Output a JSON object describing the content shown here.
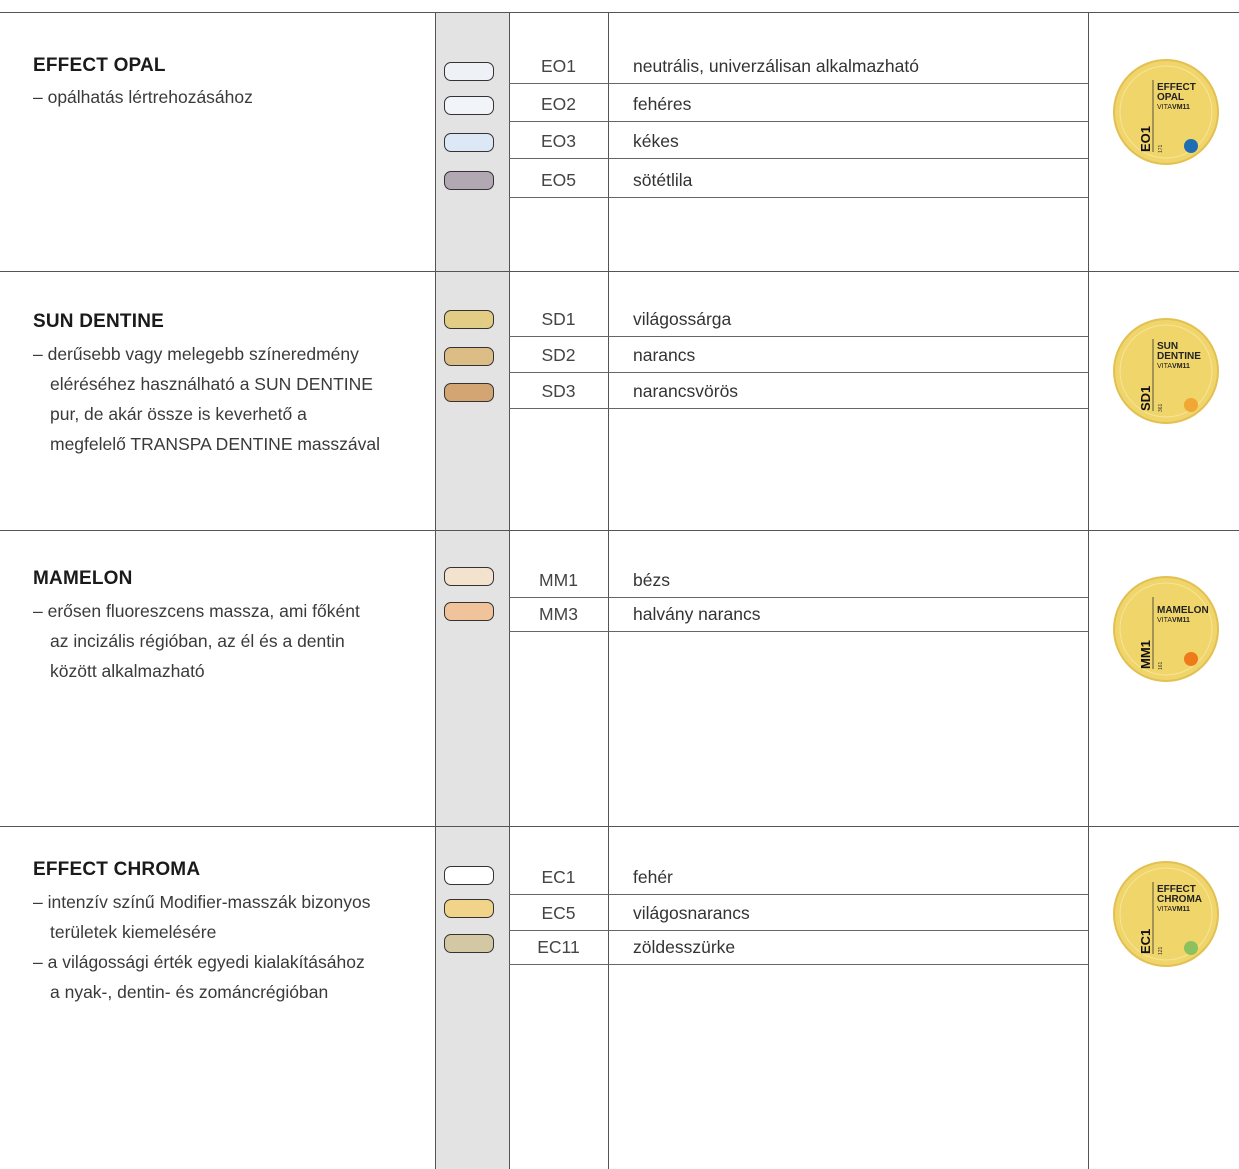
{
  "colors": {
    "line": "#555555",
    "swatch_column": "#e3e3e3",
    "jar_fill": "#f0d56a"
  },
  "sections": [
    {
      "title": "EFFECT OPAL",
      "desc": [
        "– opálhatás lértrehozásához"
      ],
      "items": [
        {
          "code": "EO1",
          "name": "neutrális, univerzálisan alkalmazható",
          "swatch": "#eef1f6"
        },
        {
          "code": "EO2",
          "name": "fehéres",
          "swatch": "#f1f4f8"
        },
        {
          "code": "EO3",
          "name": "kékes",
          "swatch": "#dde8f6"
        },
        {
          "code": "EO5",
          "name": "sötétlila",
          "swatch": "#b1a8b3"
        }
      ],
      "jar": {
        "line1": "EFFECT",
        "line2": "OPAL",
        "brand_pre": "VITA",
        "brand_bold": "VM",
        "brand_post": "11",
        "code": "EO1",
        "number": "171",
        "dot": "#1f6db2"
      }
    },
    {
      "title": "SUN DENTINE",
      "desc": [
        "– derűsebb vagy melegebb színeredmény",
        "elérés­éhez használható a SUN DENTINE",
        "pur, de akár össze is keverhető a",
        "megfelelő TRANSPA DENTINE masszával"
      ],
      "items": [
        {
          "code": "SD1",
          "name": "világossárga",
          "swatch": "#e3cc84"
        },
        {
          "code": "SD2",
          "name": "narancs",
          "swatch": "#dcbd85"
        },
        {
          "code": "SD3",
          "name": "narancsvörös",
          "swatch": "#d2a572"
        }
      ],
      "jar": {
        "line1": "SUN",
        "line2": "DENTINE",
        "brand_pre": "VITA",
        "brand_bold": "VM",
        "brand_post": "11",
        "code": "SD1",
        "number": "361",
        "dot": "#f1a733"
      }
    },
    {
      "title": "MAMELON",
      "desc": [
        "– erősen fluoreszcens massza, ami főként",
        "az incizális régióban, az él és a dentin",
        "között alkalmazható"
      ],
      "items": [
        {
          "code": "MM1",
          "name": "bézs",
          "swatch": "#f3e2cd"
        },
        {
          "code": "MM3",
          "name": "halvány narancs",
          "swatch": "#f0c39a"
        }
      ],
      "jar": {
        "line1": "MAMELON",
        "line2": "",
        "brand_pre": "VITA",
        "brand_bold": "VM",
        "brand_post": "11",
        "code": "MM1",
        "number": "161",
        "dot": "#ee7b1a"
      }
    },
    {
      "title": "EFFECT CHROMA",
      "desc": [
        "– intenzív színű Modifier-masszák bizonyos",
        "területek kiemelésére",
        "– a világossági érték egyedi kialakításához",
        "a nyak-, dentin- és zománcrégióban"
      ],
      "items": [
        {
          "code": "EC1",
          "name": "fehér",
          "swatch": "#ffffff"
        },
        {
          "code": "EC5",
          "name": "világosnarancs",
          "swatch": "#f1d38a"
        },
        {
          "code": "EC11",
          "name": "zöldesszürke",
          "swatch": "#d4c7a4"
        }
      ],
      "jar": {
        "line1": "EFFECT",
        "line2": "CHROMA",
        "brand_pre": "VITA",
        "brand_bold": "VM",
        "brand_post": "11",
        "code": "EC1",
        "number": "121",
        "dot": "#8dc15d"
      }
    }
  ]
}
